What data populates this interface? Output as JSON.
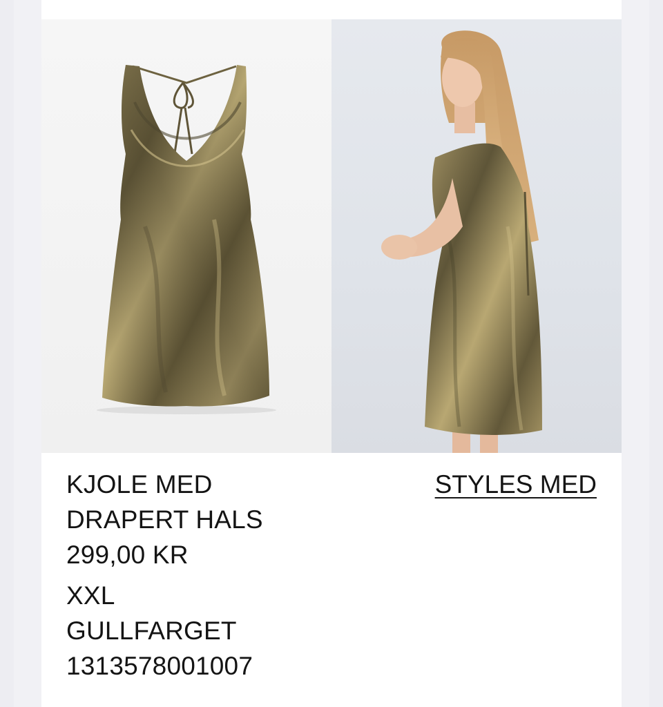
{
  "product": {
    "name_line1": "KJOLE MED",
    "name_line2": "DRAPERT HALS",
    "price": "299,00 KR",
    "size": "XXL",
    "color": "GULLFARGET",
    "article_number": "1313578001007"
  },
  "links": {
    "styles_with": "STYLES MED"
  },
  "images": {
    "product_image": "gold-cowl-neck-dress-flatlay",
    "model_image": "model-wearing-gold-dress"
  },
  "colors": {
    "dress_gold": "#8e7f4f",
    "dress_dark": "#4e4630",
    "dress_light": "#c9b982",
    "hair": "#c99a62",
    "skin": "#e9c2a7"
  }
}
